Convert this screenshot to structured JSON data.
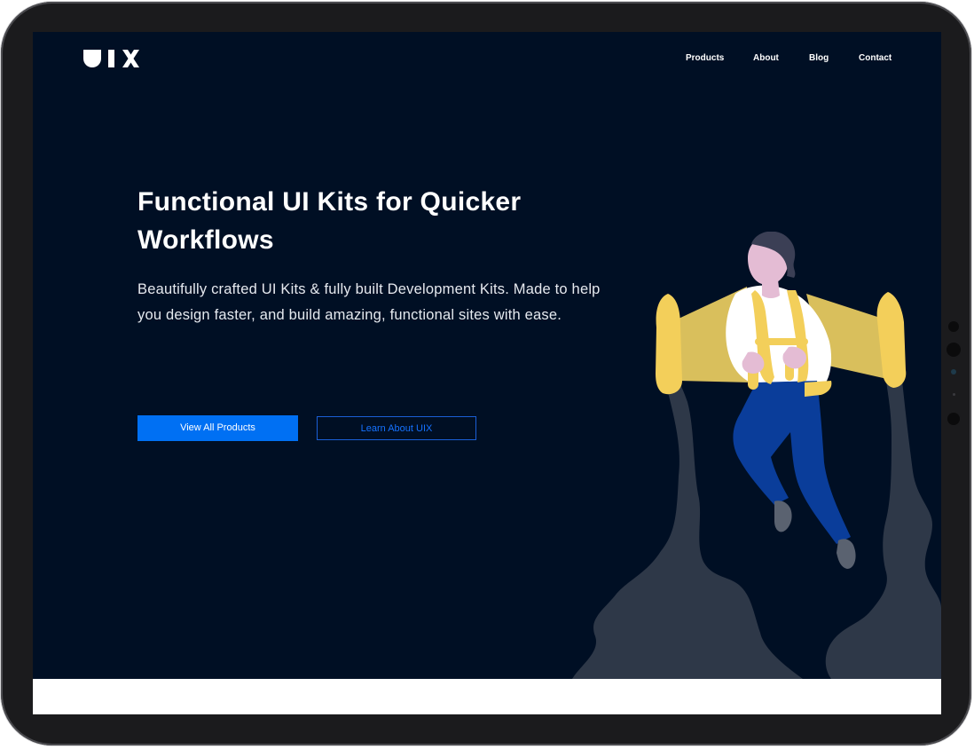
{
  "brand": {
    "logo_text": "UIX"
  },
  "nav": {
    "items": [
      {
        "label": "Products"
      },
      {
        "label": "About"
      },
      {
        "label": "Blog"
      },
      {
        "label": "Contact"
      }
    ]
  },
  "hero": {
    "headline": "Functional UI Kits for Quicker Workflows",
    "subtext": "Beautifully crafted UI Kits & fully built Development Kits. Made to help you design faster, and build amazing, functional sites with ease.",
    "primary_button": "View All Products",
    "secondary_button": "Learn About UIX"
  },
  "illustration": {
    "icon": "jetpack-person-illustration"
  },
  "colors": {
    "background": "#000f24",
    "accent": "#0070f3",
    "smoke": "#2e3848",
    "jetpack": "#f3cf5a",
    "trousers": "#0a3d9a",
    "skin": "#e4bcd4"
  }
}
